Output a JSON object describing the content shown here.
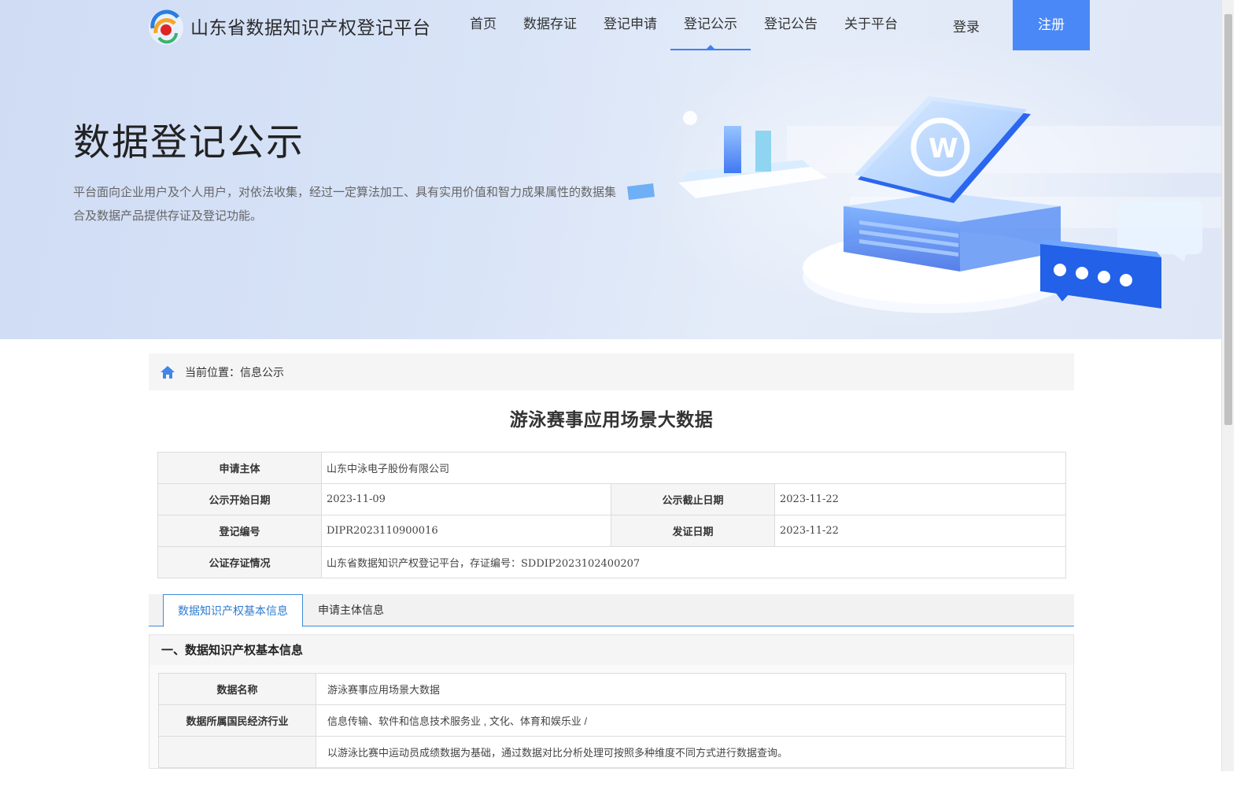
{
  "header": {
    "site_title": "山东省数据知识产权登记平台",
    "nav": [
      {
        "label": "首页"
      },
      {
        "label": "数据存证"
      },
      {
        "label": "登记申请"
      },
      {
        "label": "登记公示",
        "active": true
      },
      {
        "label": "登记公告"
      },
      {
        "label": "关于平台"
      }
    ],
    "login_label": "登录",
    "register_label": "注册"
  },
  "hero": {
    "title": "数据登记公示",
    "description": "平台面向企业用户及个人用户，对依法收集，经过一定算法加工、具有实用价值和智力成果属性的数据集合及数据产品提供存证及登记功能。"
  },
  "breadcrumb": {
    "prefix": "当前位置：",
    "current": "信息公示"
  },
  "detail": {
    "title": "游泳赛事应用场景大数据",
    "applicant_label": "申请主体",
    "applicant_value": "山东中泳电子股份有限公司",
    "start_label": "公示开始日期",
    "start_value": "2023-11-09",
    "end_label": "公示截止日期",
    "end_value": "2023-11-22",
    "reg_no_label": "登记编号",
    "reg_no_value": "DIPR2023110900016",
    "issue_label": "发证日期",
    "issue_value": "2023-11-22",
    "notary_label": "公证存证情况",
    "notary_value": "山东省数据知识产权登记平台，存证编号：SDDIP2023102400207"
  },
  "tabs": [
    {
      "label": "数据知识产权基本信息",
      "active": true
    },
    {
      "label": "申请主体信息"
    }
  ],
  "section": {
    "heading": "一、数据知识产权基本信息",
    "rows": [
      {
        "label": "数据名称",
        "value": "游泳赛事应用场景大数据"
      },
      {
        "label": "数据所属国民经济行业",
        "value": "信息传输、软件和信息技术服务业 , 文化、体育和娱乐业 /"
      },
      {
        "label": "",
        "value": "以游泳比赛中运动员成绩数据为基础，通过数据对比分析处理可按照多种维度不同方式进行数据查询。"
      }
    ]
  },
  "colors": {
    "accent": "#4a88f7",
    "tab_border": "#3c8bd9",
    "hero_bg": "#d9e4f7"
  }
}
